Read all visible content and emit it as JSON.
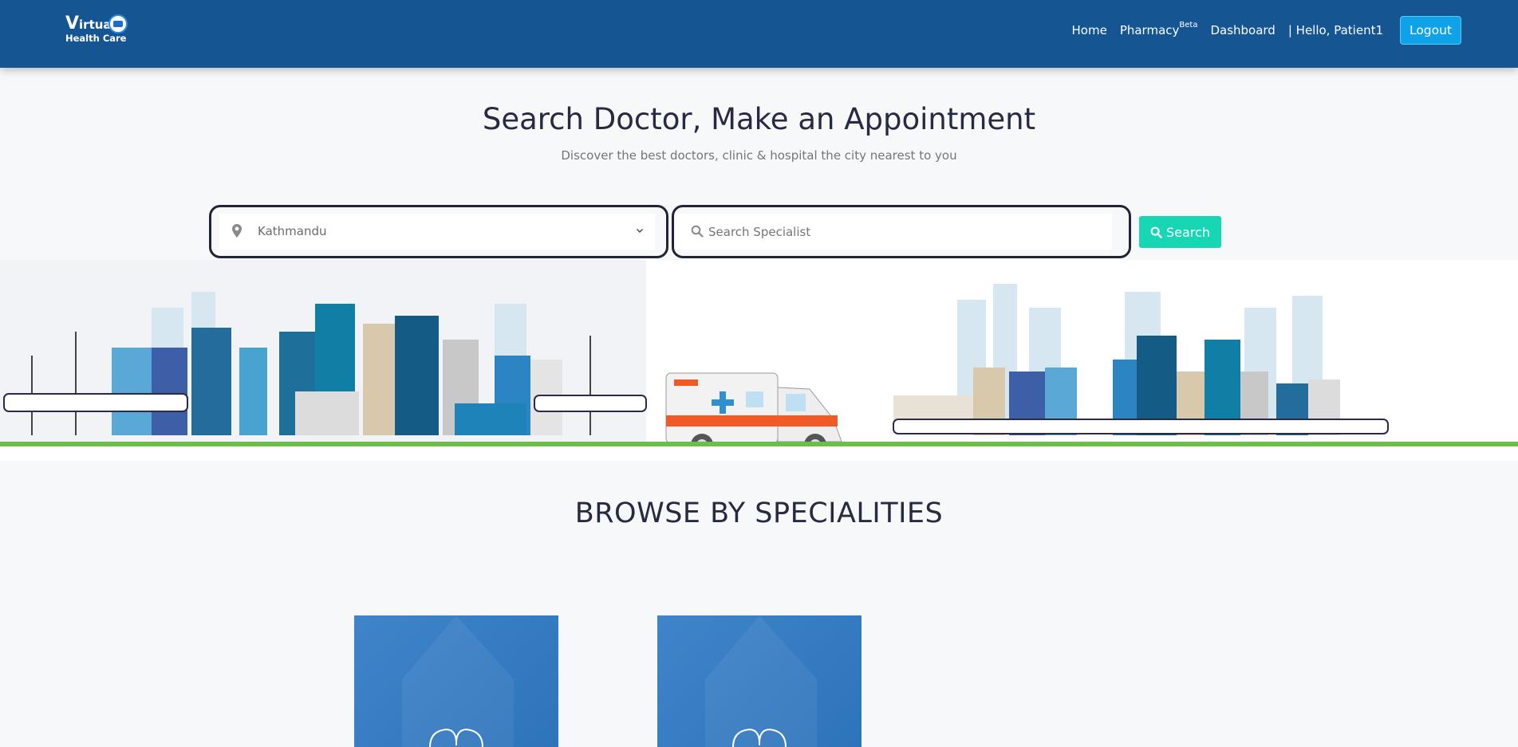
{
  "navbar": {
    "logo": {
      "line1": "Virtual",
      "line2": "Health Care"
    },
    "links": {
      "home": "Home",
      "pharmacy": "Pharmacy",
      "pharmacy_badge": "Beta",
      "dashboard": "Dashboard",
      "greeting": "| Hello, Patient1"
    },
    "logout_label": "Logout"
  },
  "hero": {
    "title": "Search Doctor, Make an Appointment",
    "subtitle": "Discover the best doctors, clinic & hospital the city nearest to you"
  },
  "search": {
    "location_value": "Kathmandu",
    "specialist_placeholder": "Search Specialist",
    "button_label": "Search"
  },
  "specialities": {
    "title": "BROWSE BY SPECIALITIES"
  },
  "colors": {
    "navbar": "#155592",
    "search_button": "#16d6b3",
    "logout_button": "#0fa2e8",
    "card": "#2f7ac5"
  },
  "icons": [
    "location-pin-icon",
    "chevron-down-icon",
    "search-icon",
    "kidney-icon"
  ]
}
